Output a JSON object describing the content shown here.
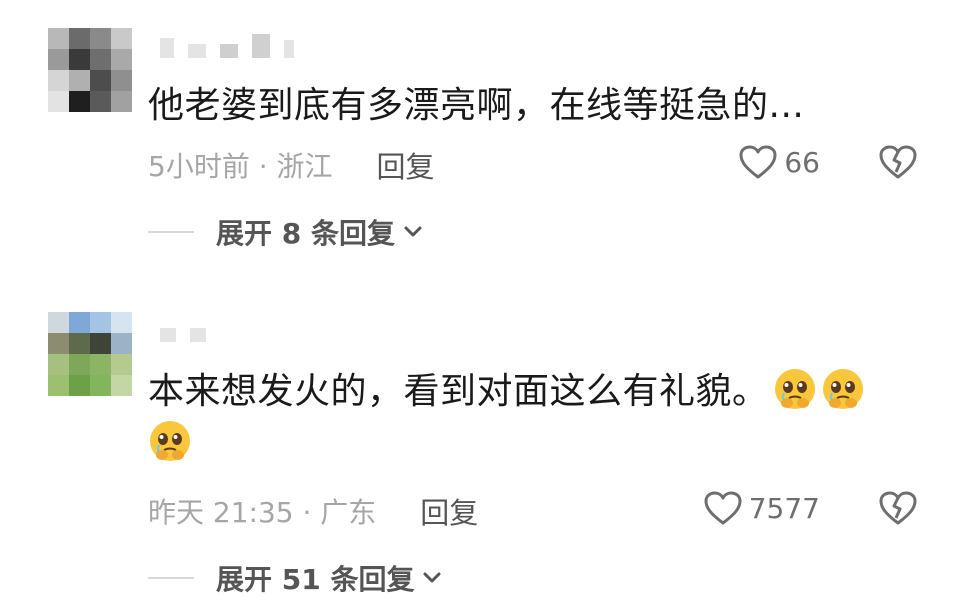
{
  "comments": [
    {
      "text": "他老婆到底有多漂亮啊，在线等挺急的...",
      "meta": "5小时前 · 浙江",
      "reply_label": "回复",
      "likes": "66",
      "expand_label": "展开 8 条回复"
    },
    {
      "text": "本来想发火的，看到对面这么有礼貌。",
      "emoji_name": "pleading-face-emoji",
      "emoji_count": 3,
      "meta": "昨天 21:35 · 广东",
      "reply_label": "回复",
      "likes": "7577",
      "expand_label": "展开 51 条回复"
    }
  ],
  "icons": {
    "like": "heart-outline-icon",
    "dislike": "broken-heart-icon",
    "expand": "chevron-down-icon"
  },
  "colors": {
    "text": "#1a1a1a",
    "meta": "#a6a6a6",
    "reply": "#555555",
    "icon": "#6e6e6e"
  }
}
